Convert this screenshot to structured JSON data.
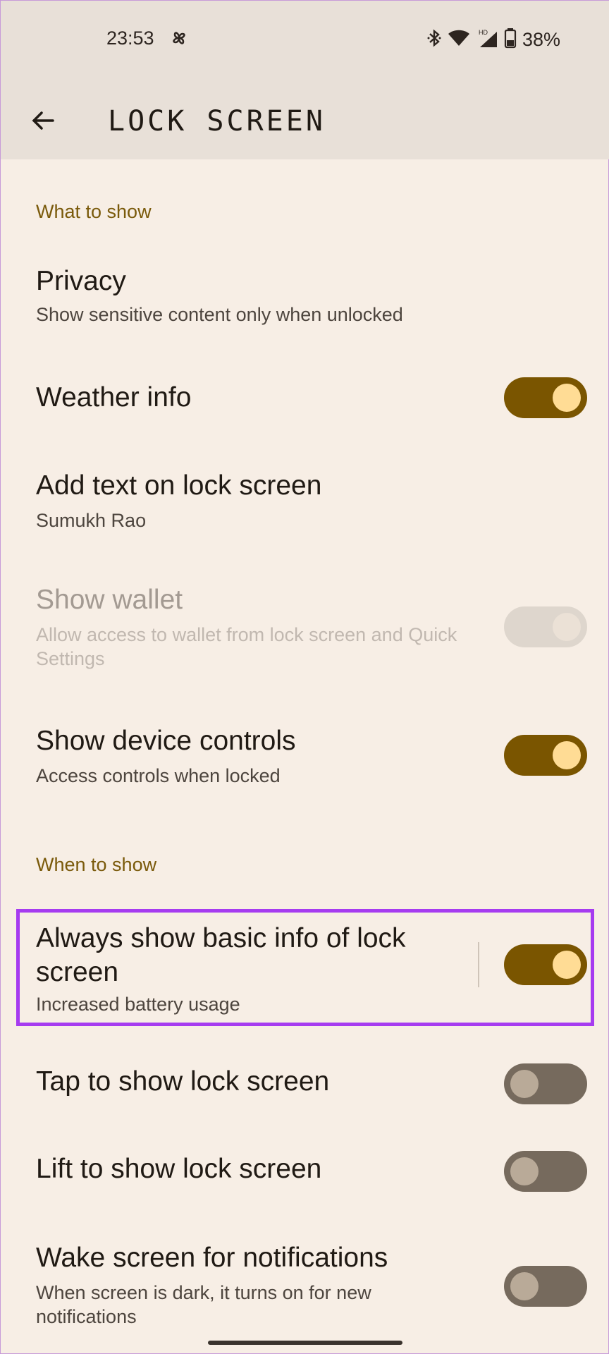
{
  "status_bar": {
    "time": "23:53",
    "battery": "38%",
    "icons": [
      "pinwheel-icon",
      "bluetooth-icon",
      "wifi-icon",
      "hd-signal-icon",
      "battery-icon"
    ]
  },
  "app_bar": {
    "title": "LOCK SCREEN",
    "back_icon": "arrow-left-icon"
  },
  "sections": [
    {
      "header": "What to show",
      "items": [
        {
          "title": "Privacy",
          "subtitle": "Show sensitive content only when unlocked",
          "toggle": null
        },
        {
          "title": "Weather info",
          "subtitle": "",
          "toggle": "on"
        },
        {
          "title": "Add text on lock screen",
          "subtitle": "Sumukh Rao",
          "toggle": null
        },
        {
          "title": "Show wallet",
          "subtitle": "Allow access to wallet from lock screen and Quick Settings",
          "toggle": "disabled"
        },
        {
          "title": "Show device controls",
          "subtitle": "Access controls when locked",
          "toggle": "on"
        }
      ]
    },
    {
      "header": "When to show",
      "items": [
        {
          "title": "Always show basic info of lock screen",
          "subtitle": "Increased battery usage",
          "toggle": "on"
        },
        {
          "title": "Tap to show lock screen",
          "subtitle": "",
          "toggle": "off"
        },
        {
          "title": "Lift to show lock screen",
          "subtitle": "",
          "toggle": "off"
        },
        {
          "title": "Wake screen for notifications",
          "subtitle": "When screen is dark, it turns on for new notifications",
          "toggle": "off"
        }
      ]
    }
  ],
  "colors": {
    "accent": "#7a5500",
    "knob_on": "#ffdc95",
    "header": "#7a5a0b",
    "background": "#f7eee5",
    "highlight": "#a63bf0"
  }
}
